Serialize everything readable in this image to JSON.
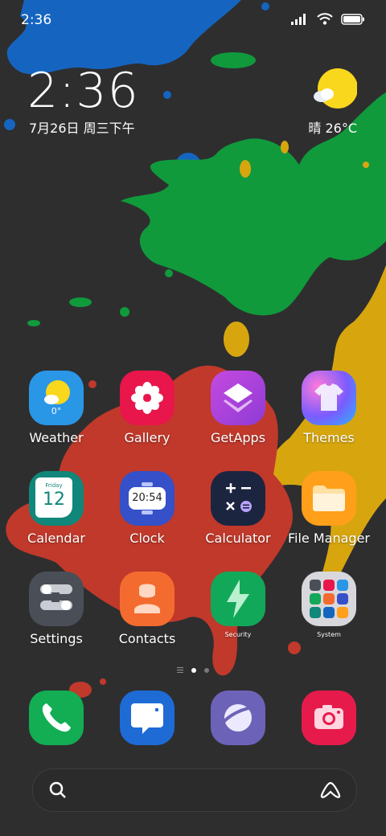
{
  "status_bar": {
    "time": "2:36",
    "icons": [
      "signal-icon",
      "wifi-icon",
      "battery-icon"
    ]
  },
  "clock_widget": {
    "time": "2:36",
    "date": "7月26日 周三下午"
  },
  "weather_widget": {
    "condition": "晴",
    "temp": "26°C",
    "icon": "sun-icon"
  },
  "apps": [
    {
      "label": "Weather",
      "icon": "weather-icon",
      "temp": "0°"
    },
    {
      "label": "Gallery",
      "icon": "flower-icon"
    },
    {
      "label": "GetApps",
      "icon": "layers-icon"
    },
    {
      "label": "Themes",
      "icon": "shirt-icon"
    },
    {
      "label": "Calendar",
      "icon": "calendar-icon",
      "weekday": "Friday",
      "day": "12"
    },
    {
      "label": "Clock",
      "icon": "clock-icon",
      "time": "20:54"
    },
    {
      "label": "Calculator",
      "icon": "calculator-icon"
    },
    {
      "label": "File Manager",
      "icon": "folder-icon"
    },
    {
      "label": "Settings",
      "icon": "toggles-icon"
    },
    {
      "label": "Contacts",
      "icon": "person-icon"
    },
    {
      "label": "Security",
      "icon": "bolt-icon"
    },
    {
      "label": "System",
      "icon": "folder-grid-icon"
    }
  ],
  "page_indicator": {
    "pages": 2,
    "current": 1
  },
  "dock": [
    {
      "name": "phone",
      "icon": "phone-icon"
    },
    {
      "name": "messages",
      "icon": "message-icon"
    },
    {
      "name": "browser",
      "icon": "planet-icon"
    },
    {
      "name": "camera",
      "icon": "camera-icon"
    }
  ],
  "search": {
    "icon": "search-icon",
    "assistant_icon": "app-vault-icon"
  },
  "colors": {
    "background": "#2e2e2f",
    "paint_blue": "#1565c0",
    "paint_green": "#109a3c",
    "paint_yellow": "#d7a60f",
    "paint_red": "#c0392b"
  }
}
